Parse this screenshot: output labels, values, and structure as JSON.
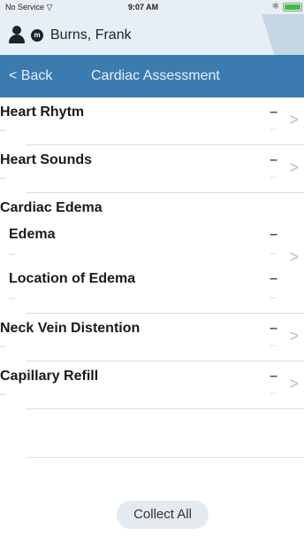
{
  "status": {
    "carrier": "No Service",
    "wifi_icon": "wifi-icon",
    "time": "9:07 AM",
    "battery_color": "#3cc13c"
  },
  "patient": {
    "name": "Burns, Frank",
    "badge": "m",
    "avatar_icon": "person-icon"
  },
  "nav": {
    "back_label": "< Back",
    "title": "Cardiac Assessment",
    "color": "#3b7bb0"
  },
  "items": [
    {
      "title": "Heart Rhytm",
      "value": "–",
      "sub": "–"
    },
    {
      "title": "Heart Sounds",
      "value": "–",
      "sub": "–"
    },
    {
      "title": "Cardiac Edema",
      "subitems": [
        {
          "title": "Edema",
          "value": "–",
          "sub": "–"
        },
        {
          "title": "Location of Edema",
          "value": "–",
          "sub": "–"
        }
      ]
    },
    {
      "title": "Neck Vein Distention",
      "value": "–",
      "sub": "–"
    },
    {
      "title": "Capillary Refill",
      "value": "–",
      "sub": "–"
    }
  ],
  "chevron": ">",
  "collect_all_label": "Collect All"
}
